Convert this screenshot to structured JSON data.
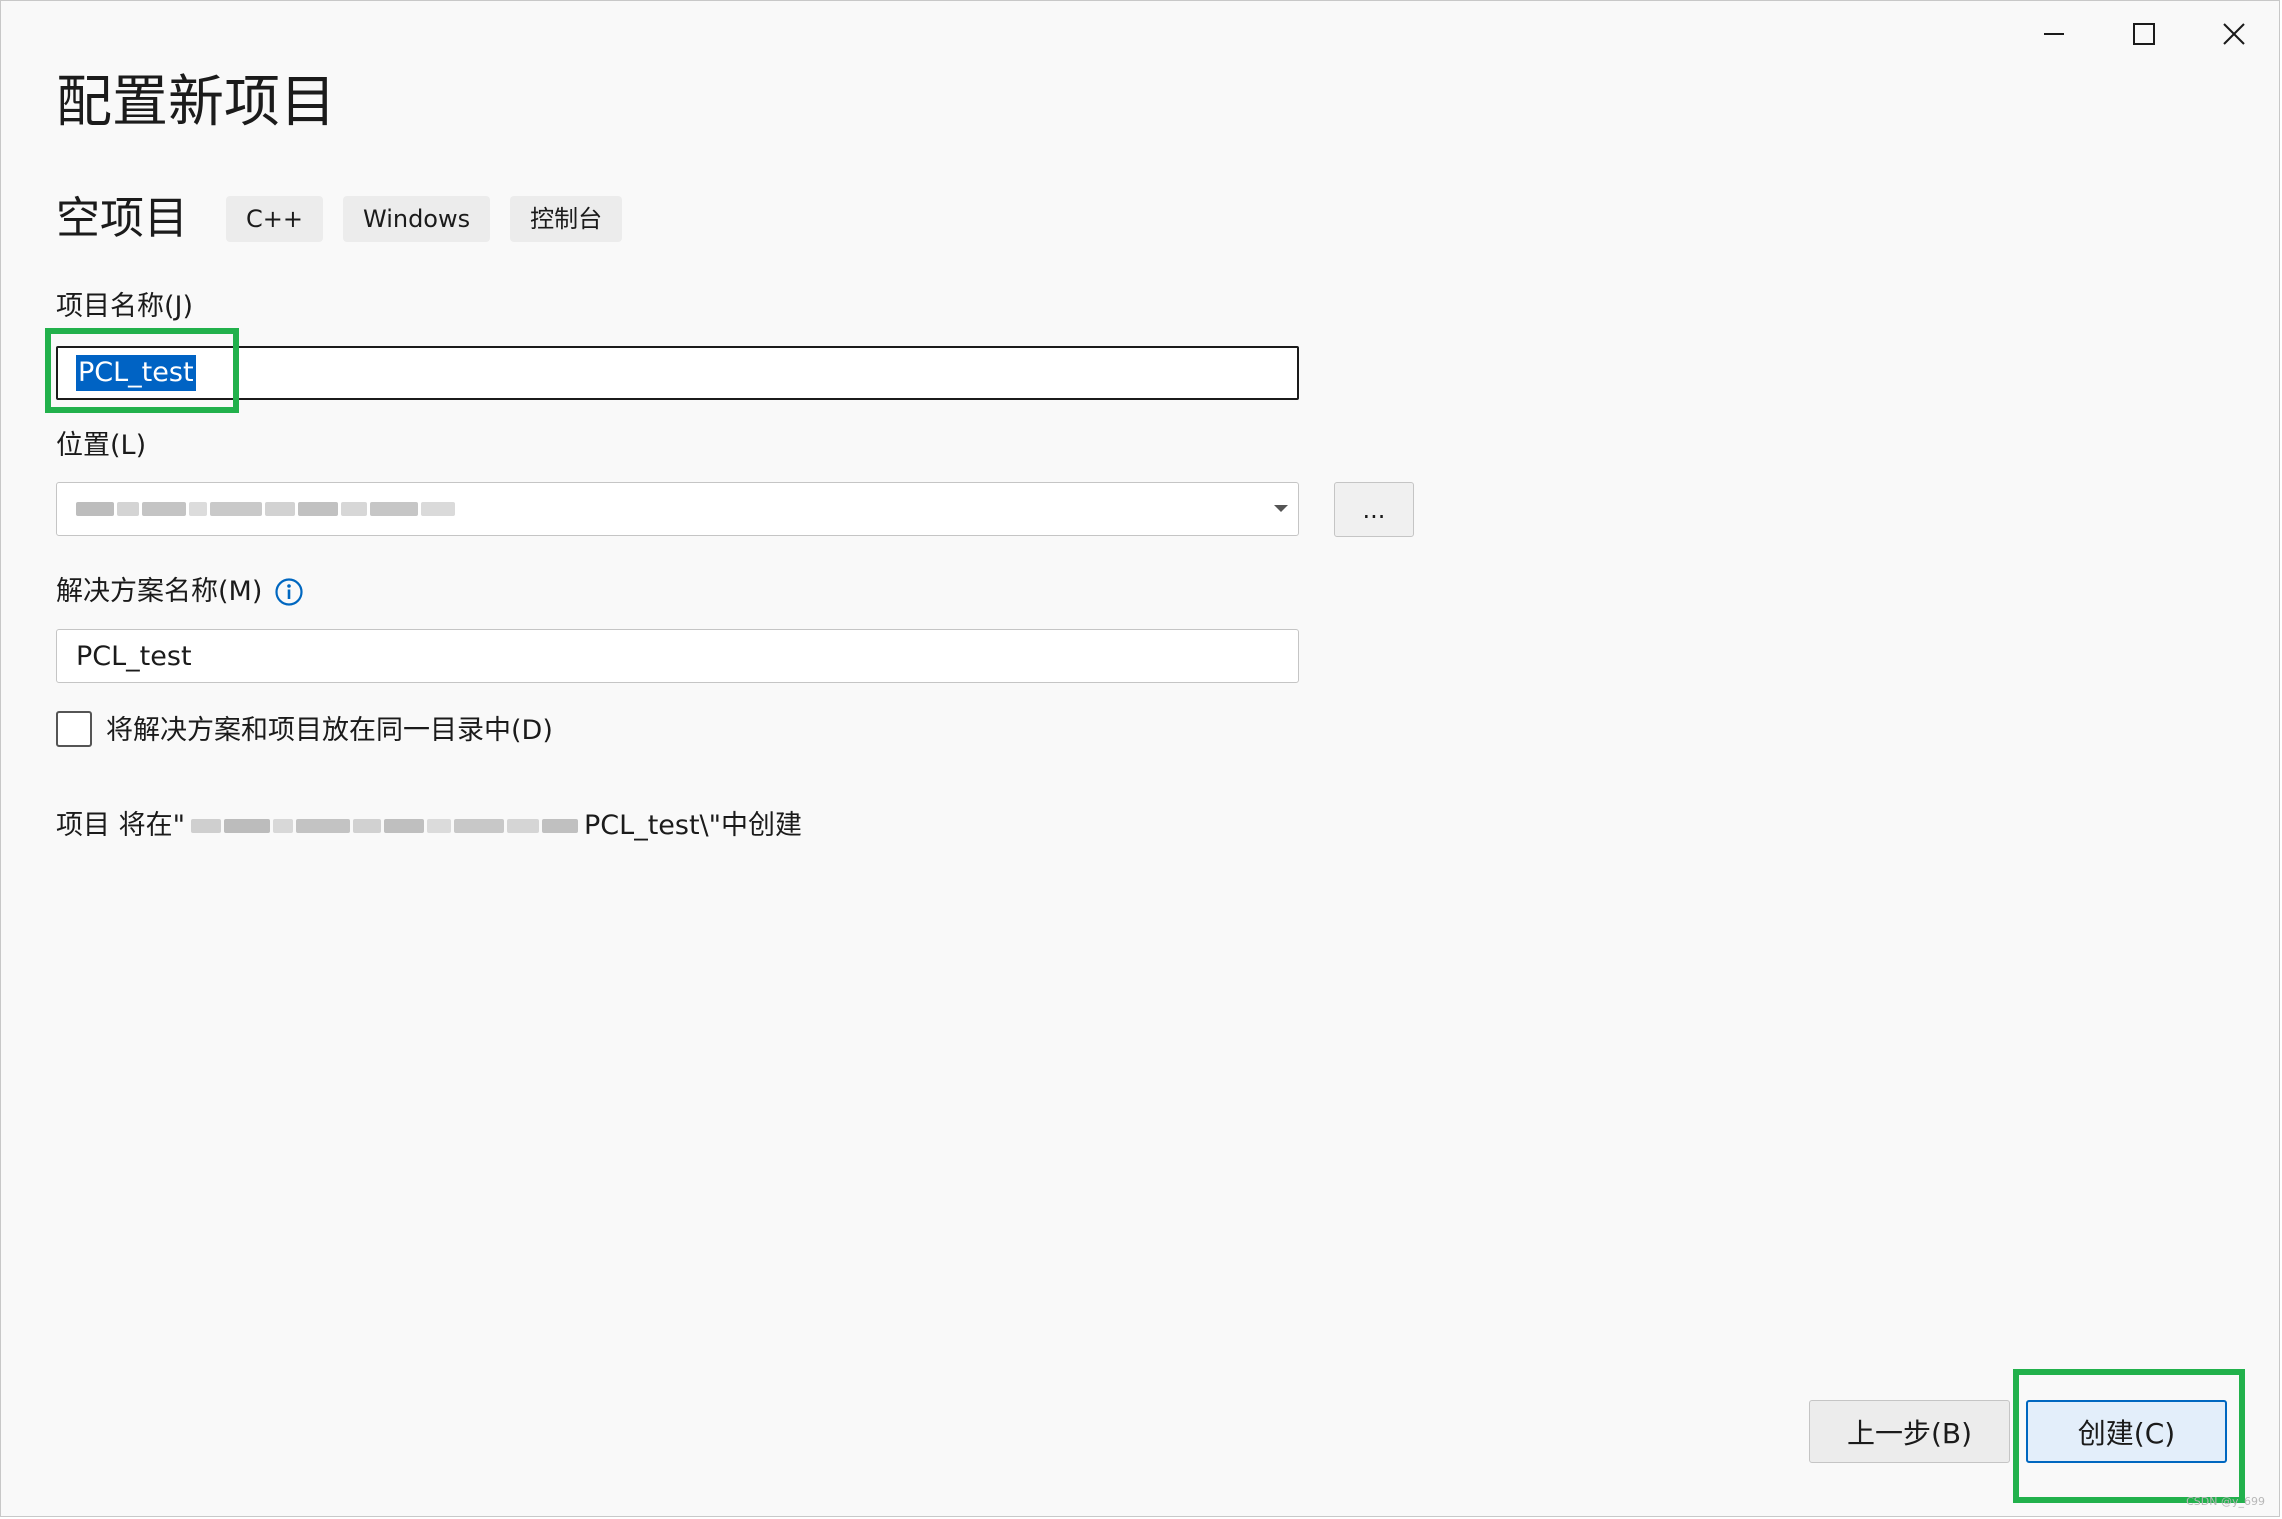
{
  "window": {
    "controls": [
      "minimize",
      "maximize",
      "close"
    ]
  },
  "title": "配置新项目",
  "template": {
    "name": "空项目",
    "tags": [
      "C++",
      "Windows",
      "控制台"
    ]
  },
  "project_name": {
    "label": "项目名称(J)",
    "value": "PCL_test"
  },
  "location": {
    "label": "位置(L)",
    "browse_label": "..."
  },
  "solution_name": {
    "label": "解决方案名称(M)",
    "value": "PCL_test"
  },
  "same_directory": {
    "label": "将解决方案和项目放在同一目录中(D)",
    "checked": false
  },
  "path_info": {
    "prefix": "项目 将在\"",
    "suffix": "PCL_test\\\"中创建"
  },
  "buttons": {
    "back": "上一步(B)",
    "create": "创建(C)"
  },
  "watermark": "CSDN @y_699",
  "colors": {
    "selection": "#0063c4",
    "highlight_box": "#22b14c",
    "primary_button_border": "#0067c0",
    "info_icon": "#0067c0"
  }
}
